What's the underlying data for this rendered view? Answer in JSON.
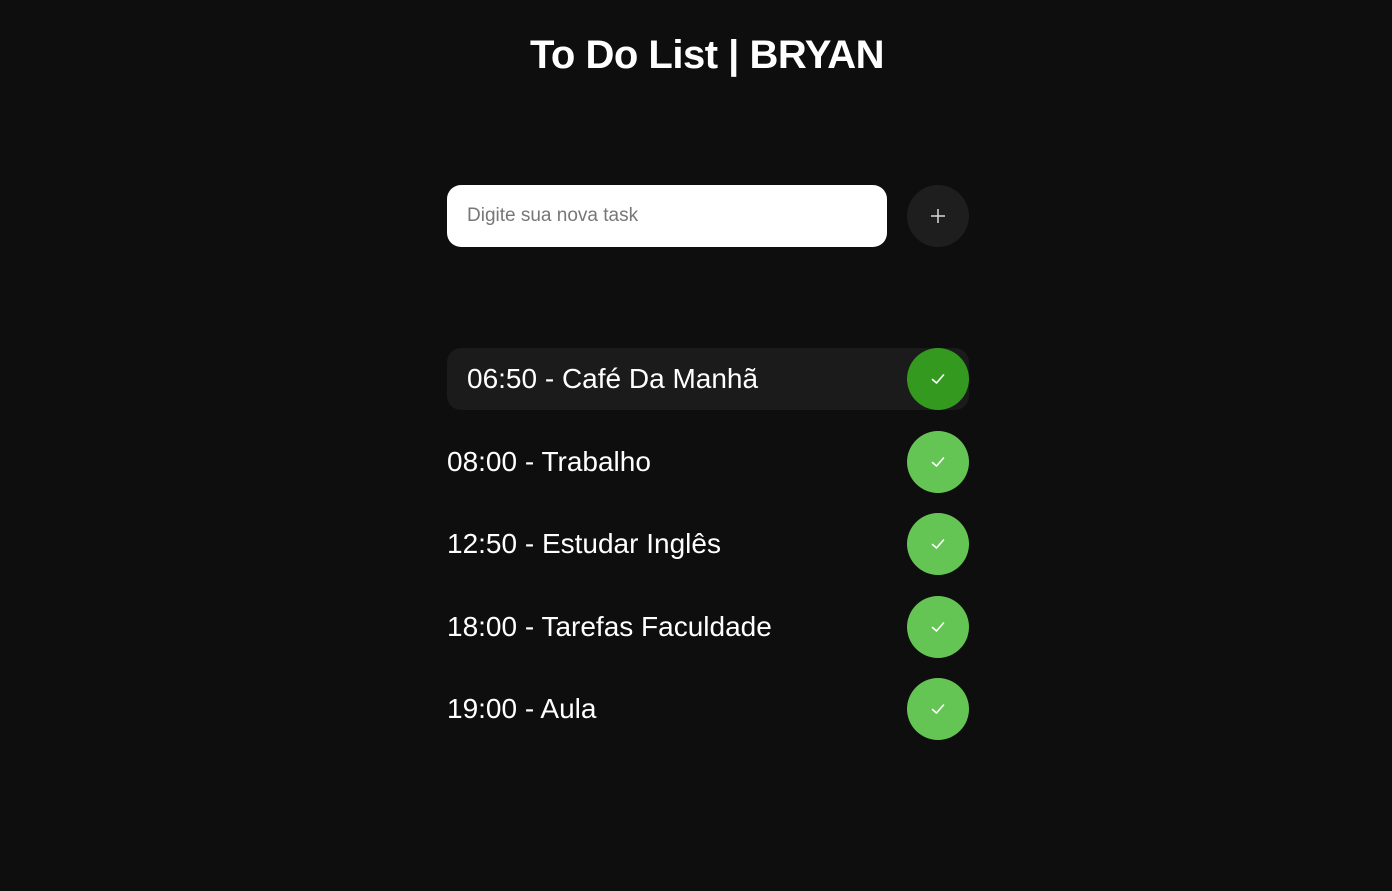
{
  "header": {
    "title": "To Do List | BRYAN"
  },
  "new_task": {
    "placeholder": "Digite sua nova task",
    "value": "",
    "add_icon": "plus-icon"
  },
  "tasks": [
    {
      "label": "06:50 - Café Da Manhã",
      "hovered": true
    },
    {
      "label": "08:00 - Trabalho",
      "hovered": false
    },
    {
      "label": "12:50 - Estudar Inglês",
      "hovered": false
    },
    {
      "label": "18:00 - Tarefas Faculdade",
      "hovered": false
    },
    {
      "label": "19:00 - Aula",
      "hovered": false
    }
  ],
  "colors": {
    "background": "#0e0e0e",
    "check_button": "#65c554",
    "check_button_hover": "#339a1f",
    "add_button": "#1e1e1e",
    "task_hover_bg": "#1b1b1b"
  },
  "icons": {
    "add": "plus-icon",
    "complete": "check-icon"
  }
}
